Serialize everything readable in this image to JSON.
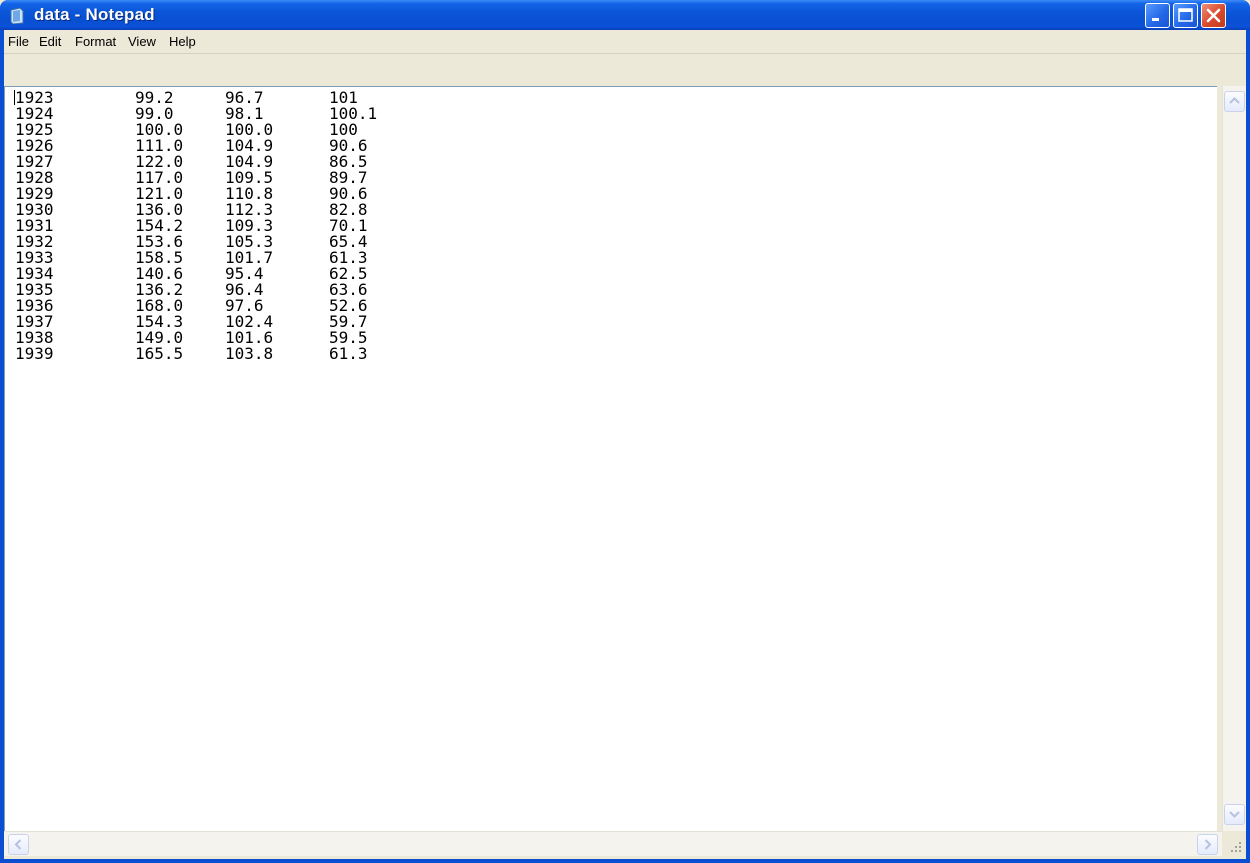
{
  "window": {
    "title": "data - Notepad",
    "icon": "notepad-icon"
  },
  "titlebar_buttons": [
    "minimize-icon",
    "maximize-icon",
    "close-icon"
  ],
  "menu": {
    "items": [
      "File",
      "Edit",
      "Format",
      "View",
      "Help"
    ]
  },
  "document": {
    "rows": [
      [
        "1923",
        "99.2",
        "96.7",
        "101"
      ],
      [
        "1924",
        "99.0",
        "98.1",
        "100.1"
      ],
      [
        "1925",
        "100.0",
        "100.0",
        "100"
      ],
      [
        "1926",
        "111.0",
        "104.9",
        "90.6"
      ],
      [
        "1927",
        "122.0",
        "104.9",
        "86.5"
      ],
      [
        "1928",
        "117.0",
        "109.5",
        "89.7"
      ],
      [
        "1929",
        "121.0",
        "110.8",
        "90.6"
      ],
      [
        "1930",
        "136.0",
        "112.3",
        "82.8"
      ],
      [
        "1931",
        "154.2",
        "109.3",
        "70.1"
      ],
      [
        "1932",
        "153.6",
        "105.3",
        "65.4"
      ],
      [
        "1933",
        "158.5",
        "101.7",
        "61.3"
      ],
      [
        "1934",
        "140.6",
        "95.4",
        "62.5"
      ],
      [
        "1935",
        "136.2",
        "96.4",
        "63.6"
      ],
      [
        "1936",
        "168.0",
        "97.6",
        "52.6"
      ],
      [
        "1937",
        "154.3",
        "102.4",
        "59.7"
      ],
      [
        "1938",
        "149.0",
        "101.6",
        "59.5"
      ],
      [
        "1939",
        "165.5",
        "103.8",
        "61.3"
      ]
    ]
  },
  "colors": {
    "titlebar": "#0b56d8",
    "close_button": "#d8492c",
    "chrome": "#ece9d8"
  }
}
